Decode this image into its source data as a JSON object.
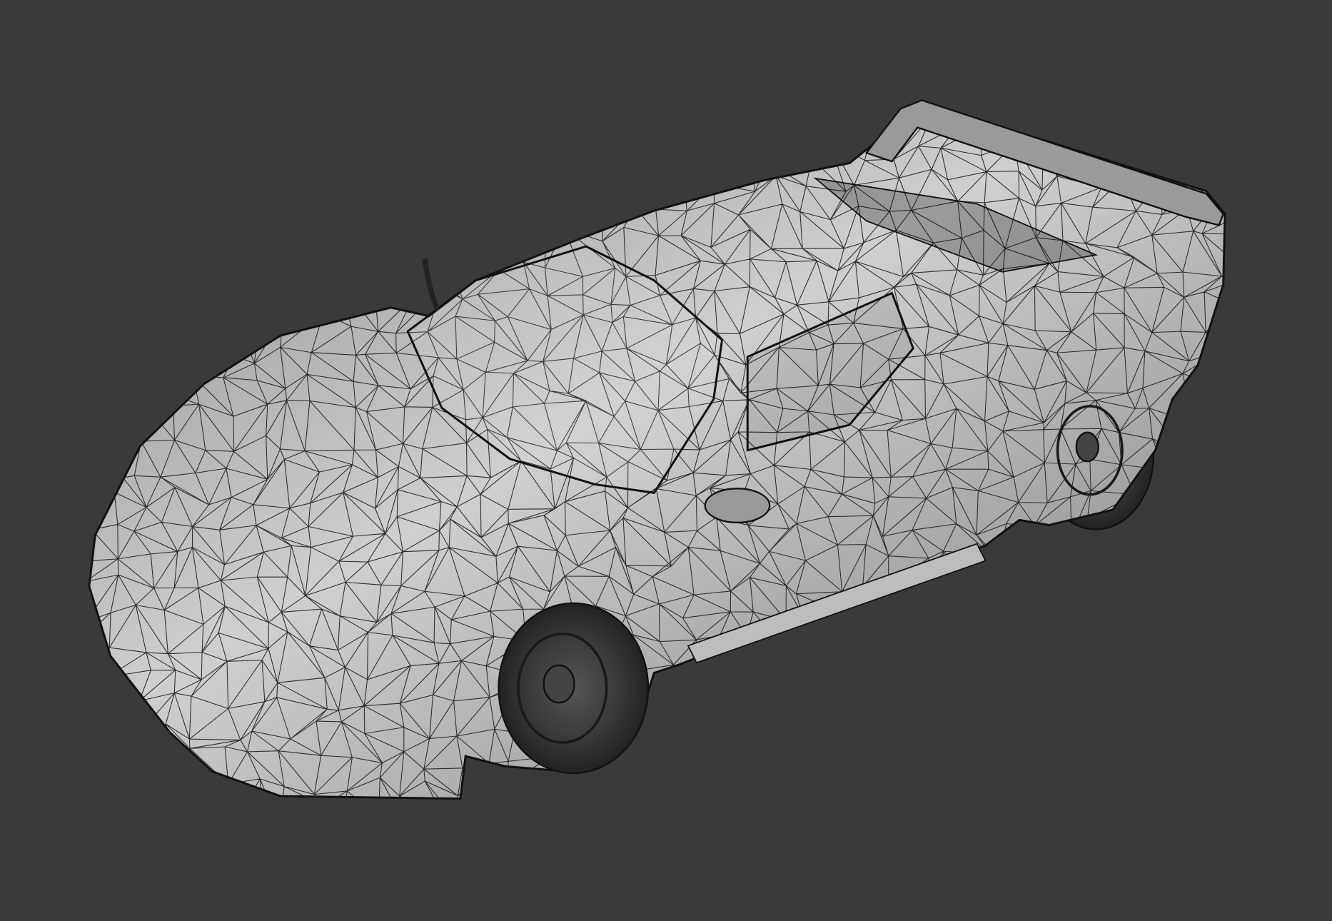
{
  "colors": {
    "background": "#3a3a3a",
    "body_light": "#cfcfcf",
    "body_mid": "#a6a6a6",
    "body_dark": "#6e6e6e",
    "wire": "#1c1c1c",
    "tire": "#2a2a2a"
  }
}
